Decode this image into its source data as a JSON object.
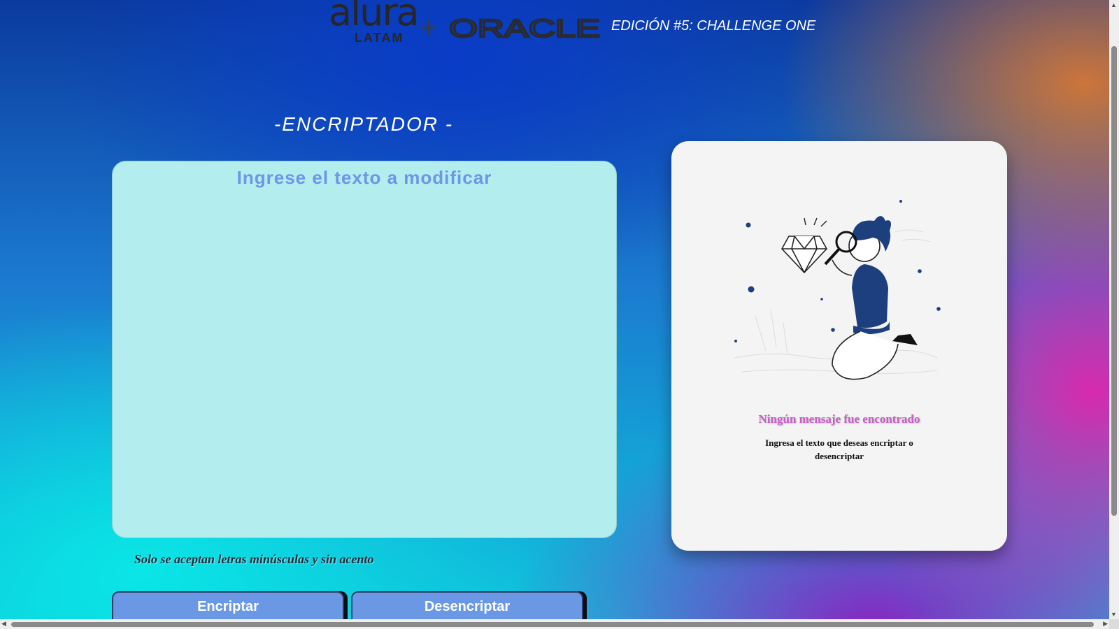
{
  "header": {
    "alura_word": "alura",
    "alura_sub": "LATAM",
    "plus": "+",
    "oracle": "ORACLE",
    "edition": "EDICIÓN #5: CHALLENGE ONE"
  },
  "main": {
    "title": "-ENCRIPTADOR -",
    "input_placeholder": "Ingrese el texto a modificar",
    "input_value": "",
    "hint": "Solo se aceptan letras minúsculas y sin acento",
    "encrypt_label": "Encriptar",
    "decrypt_label": "Desencriptar"
  },
  "output": {
    "title": "Ningún mensaje fue encontrado",
    "text": "Ingresa el texto que deseas encriptar o desencriptar"
  },
  "icons": {
    "plus": "plus-icon",
    "illustration": "magnifier-person-illustration"
  },
  "colors": {
    "input_bg": "#b3eded",
    "placeholder": "#6d95e8",
    "button_bg": "#6a98e4",
    "output_title": "#c95dc9",
    "card_bg": "#f4f4f4"
  }
}
